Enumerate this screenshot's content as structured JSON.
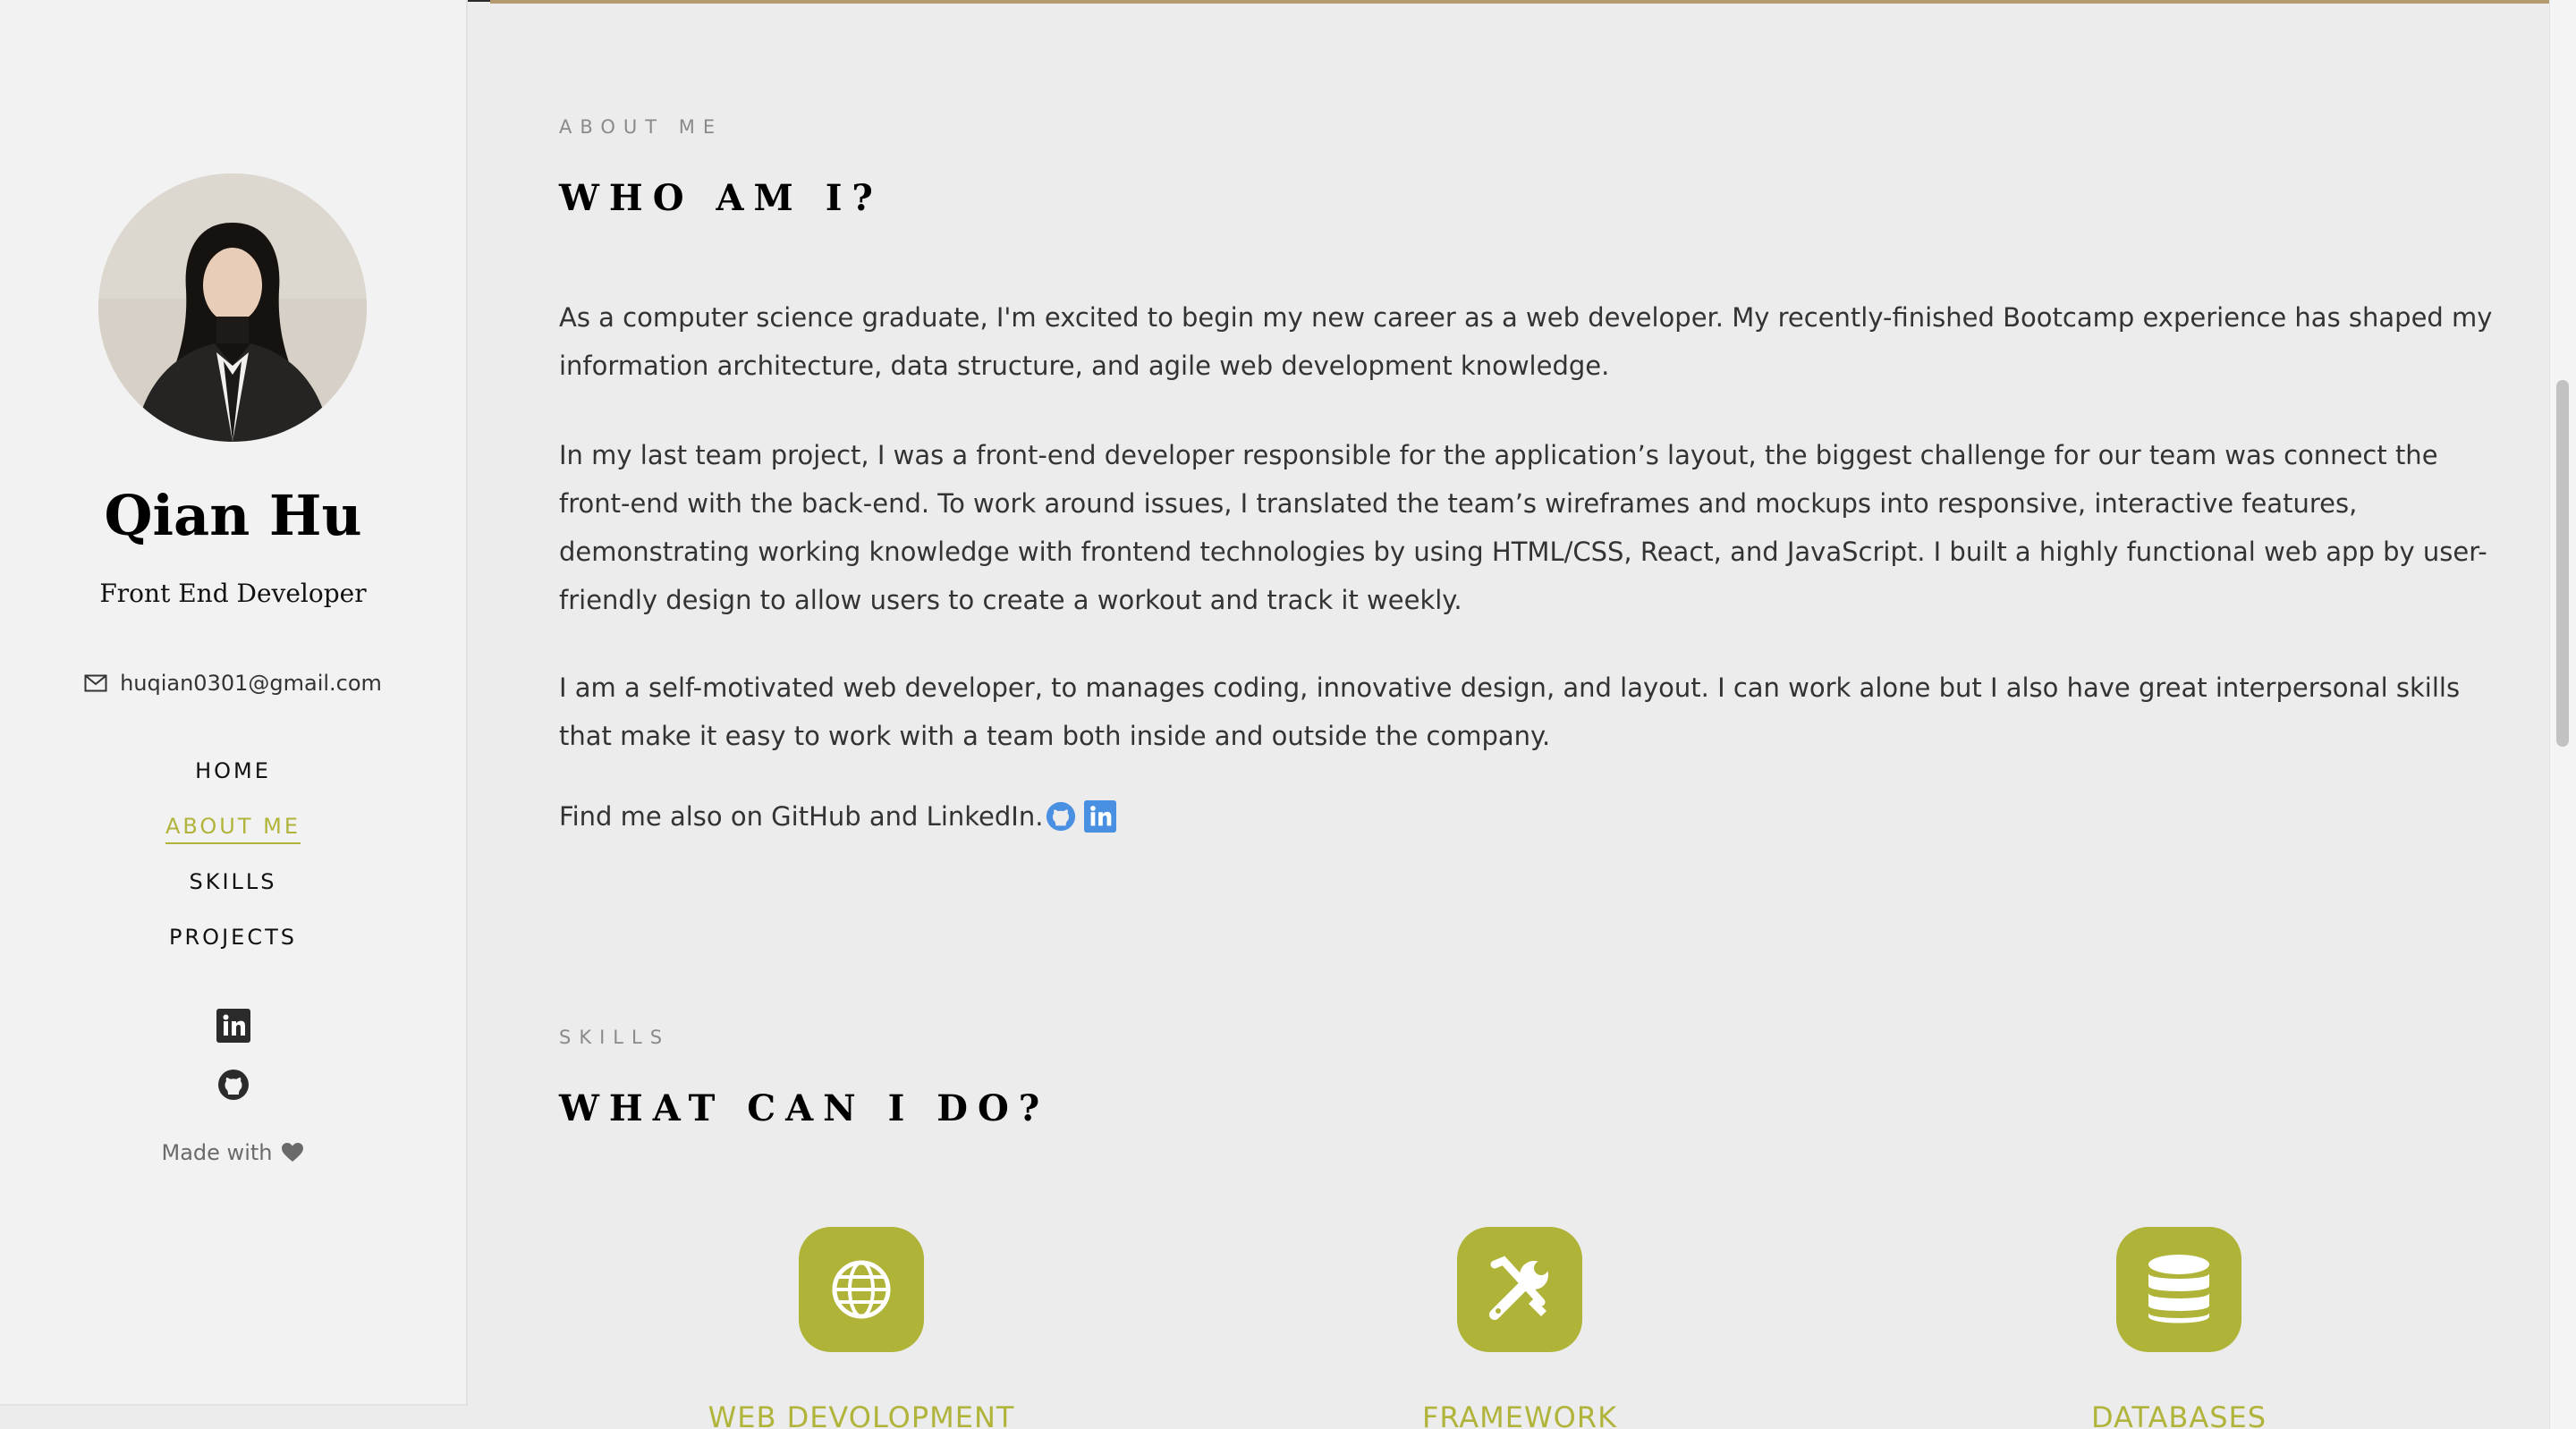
{
  "profile": {
    "name": "Qian Hu",
    "role": "Front End Developer",
    "email": "huqian0301@gmail.com"
  },
  "nav": {
    "items": [
      {
        "label": "HOME",
        "active": false
      },
      {
        "label": "ABOUT ME",
        "active": true
      },
      {
        "label": "SKILLS",
        "active": false
      },
      {
        "label": "PROJECTS",
        "active": false
      }
    ]
  },
  "sidebar_footer": {
    "made_with": "Made with"
  },
  "about": {
    "eyebrow": "ABOUT ME",
    "heading": "WHO AM I?",
    "paragraphs": [
      "As a computer science graduate, I'm excited to begin my new career as a web developer. My recently-finished Bootcamp experience has shaped my information architecture, data structure, and agile web development knowledge.",
      "In my last team project, I was a front-end developer responsible for the application’s layout, the biggest challenge for our team was connect the front-end with the back-end. To work around issues, I translated the team’s wireframes and mockups into responsive, interactive features, demonstrating working knowledge with frontend technologies by using HTML/CSS, React, and JavaScript. I built a highly functional web app by user-friendly design to allow users to create a workout and track it weekly.",
      "I am a self-motivated web developer, to manages coding, innovative design, and layout. I can work alone but I also have great interpersonal skills that make it easy to work with a team both inside and outside the company."
    ],
    "find_me": "Find me also on GitHub and LinkedIn."
  },
  "skills": {
    "eyebrow": "SKILLS",
    "heading": "WHAT CAN I DO?",
    "items": [
      {
        "label": "WEB DEVOLOPMENT",
        "icon": "globe-icon"
      },
      {
        "label": "FRAMEWORK",
        "icon": "tools-icon"
      },
      {
        "label": "DATABASES",
        "icon": "database-icon"
      }
    ]
  },
  "colors": {
    "accent": "#afb338",
    "link_blue": "#4a90e2"
  }
}
